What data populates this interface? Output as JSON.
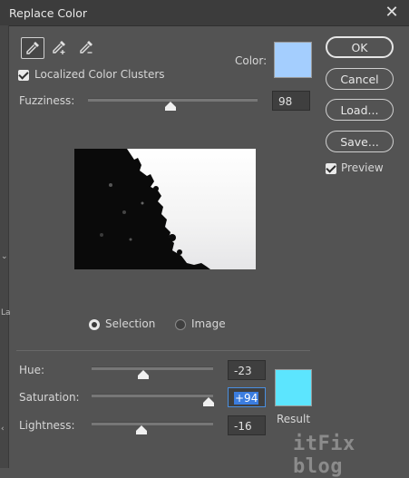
{
  "window": {
    "title": "Replace Color"
  },
  "tools": {
    "eyedropper": "eyedropper-icon",
    "add": "eyedropper-plus-icon",
    "subtract": "eyedropper-minus-icon"
  },
  "localized": {
    "label": "Localized Color Clusters",
    "checked": true
  },
  "color": {
    "label": "Color:",
    "swatch": "#a4cefe"
  },
  "fuzziness": {
    "label": "Fuzziness:",
    "value": "98"
  },
  "view": {
    "selection": "Selection",
    "image": "Image",
    "selected": "Selection"
  },
  "replacement": {
    "hue": {
      "label": "Hue:",
      "value": "-23"
    },
    "saturation": {
      "label": "Saturation:",
      "value": "+94"
    },
    "lightness": {
      "label": "Lightness:",
      "value": "-16"
    },
    "result_label": "Result",
    "result_swatch": "#5ce5fe"
  },
  "buttons": {
    "ok": "OK",
    "cancel": "Cancel",
    "load": "Load...",
    "save": "Save..."
  },
  "preview": {
    "label": "Preview",
    "checked": true
  },
  "watermark": "itFix blog"
}
